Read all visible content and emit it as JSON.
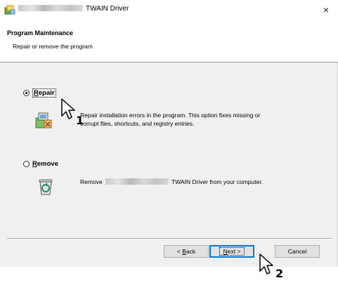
{
  "window": {
    "title": "TWAIN Driver",
    "close_label": "×"
  },
  "header": {
    "title": "Program Maintenance",
    "subtitle": "Repair or remove the program"
  },
  "options": {
    "repair": {
      "label_first": "R",
      "label_rest": "epair",
      "selected": true,
      "desc_line1": "Repair installation errors in the program. This option fixes missing or",
      "desc_line2": "corrupt files, shortcuts, and registry entries."
    },
    "remove": {
      "label_first": "R",
      "label_rest": "emove",
      "selected": false,
      "desc_before": "Remove",
      "desc_after": "TWAIN Driver from your computer."
    }
  },
  "buttons": {
    "back_prefix": "< ",
    "back_u": "B",
    "back_rest": "ack",
    "next_u": "N",
    "next_rest": "ext >",
    "cancel": "Cancel"
  },
  "callouts": {
    "first": "1",
    "second": "2"
  },
  "colors": {
    "dialog_bg": "#f0f0f0",
    "header_bg": "#ffffff",
    "default_button_border": "#0078d7"
  }
}
